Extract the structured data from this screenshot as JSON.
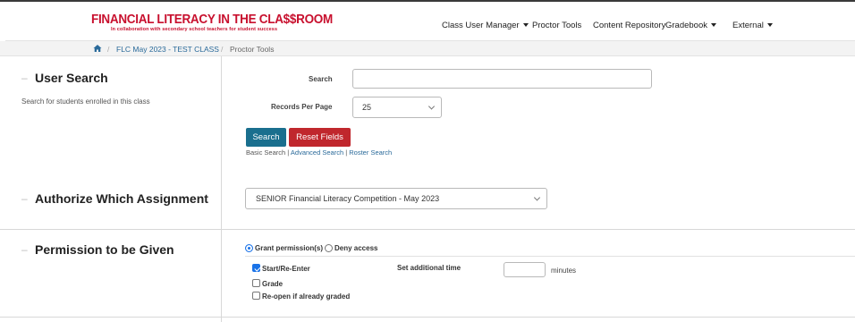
{
  "brand": {
    "title": "FINANCIAL LITERACY IN THE CLA$$ROOM",
    "subtitle": "In collaboration with secondary school teachers for student success",
    "color": "#c8102e"
  },
  "nav": {
    "items": [
      {
        "label": "Class User Manager",
        "dropdown": true
      },
      {
        "label": "Proctor Tools",
        "dropdown": false
      },
      {
        "label": "Content Repository",
        "dropdown": false
      },
      {
        "label": "Gradebook",
        "dropdown": true
      },
      {
        "label": "External",
        "dropdown": true
      }
    ]
  },
  "breadcrumb": {
    "home_icon": "home-icon",
    "class_link": "FLC May 2023 - TEST CLASS",
    "current": "Proctor Tools",
    "separator": "/"
  },
  "user_search": {
    "title": "User Search",
    "description": "Search for students enrolled in this class",
    "search_label": "Search",
    "search_value": "",
    "records_label": "Records Per Page",
    "records_value": "25",
    "search_button": "Search",
    "reset_button": "Reset Fields",
    "link_basic": "Basic Search",
    "link_advanced": "Advanced Search",
    "link_roster": "Roster Search",
    "link_sep": "|"
  },
  "authorize": {
    "title": "Authorize Which Assignment",
    "selected_assignment": "SENIOR Financial Literacy Competition - May 2023"
  },
  "permission": {
    "title": "Permission to be Given",
    "grant_label": "Grant permission(s)",
    "grant_selected": true,
    "deny_label": "Deny access",
    "deny_selected": false,
    "options": [
      {
        "label": "Start/Re-Enter",
        "checked": true
      },
      {
        "label": "Grade",
        "checked": false
      },
      {
        "label": "Re-open if already graded",
        "checked": false
      }
    ],
    "additional_time_label": "Set additional time",
    "additional_time_value": "",
    "minutes_label": "minutes"
  },
  "colors": {
    "search_button": "#1a6f8e",
    "reset_button": "#c0272d",
    "link": "#2a6a9a",
    "checked": "#1a73e8"
  }
}
